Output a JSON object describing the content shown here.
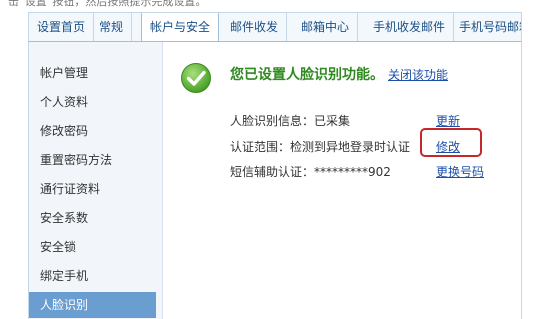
{
  "top_strip_text": "击“设置”按钮，然后按照提示完成设置。",
  "tabs": [
    {
      "label": "设置首页"
    },
    {
      "label": "常规"
    },
    {
      "label": "帐户与安全"
    },
    {
      "label": "邮件收发"
    },
    {
      "label": "邮箱中心"
    },
    {
      "label": "手机收发邮件"
    },
    {
      "label": "手机号码邮箱"
    }
  ],
  "active_tab": "帐户与安全",
  "sidebar": {
    "items": [
      {
        "label": "帐户管理"
      },
      {
        "label": "个人资料"
      },
      {
        "label": "修改密码"
      },
      {
        "label": "重置密码方法"
      },
      {
        "label": "通行证资料"
      },
      {
        "label": "安全系数"
      },
      {
        "label": "安全锁"
      },
      {
        "label": "绑定手机"
      },
      {
        "label": "人脸识别"
      }
    ],
    "active_item": "人脸识别"
  },
  "status": {
    "icon": "check-circle-icon",
    "message": "您已设置人脸识别功能。",
    "disable_link": "关闭该功能"
  },
  "details": [
    {
      "label": "人脸识别信息：已采集",
      "action": "更新"
    },
    {
      "label": "认证范围：检测到异地登录时认证",
      "action": "修改"
    },
    {
      "label": "短信辅助认证：*********902",
      "action": "更换号码"
    }
  ],
  "colors": {
    "accent_blue": "#6a9dd0",
    "success_green": "#2f8a20",
    "link_blue": "#1d4fa8",
    "highlight_red": "#c42828"
  }
}
